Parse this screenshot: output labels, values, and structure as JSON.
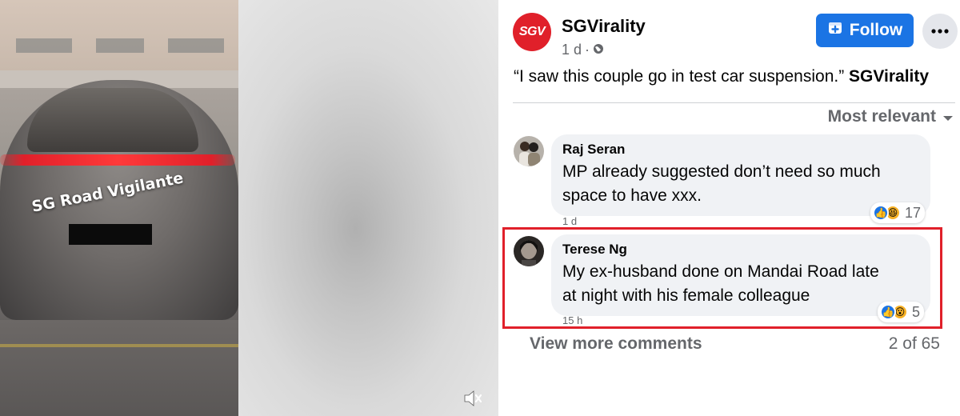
{
  "video": {
    "watermark": "SG Road Vigilante",
    "mute_icon": "speaker-muted-icon"
  },
  "post": {
    "page_name": "SGVirality",
    "avatar_text": "SGV",
    "time": "1 d",
    "separator": "·",
    "audience_icon": "globe-icon",
    "follow_label": "Follow",
    "more_icon": "more-horizontal-icon",
    "caption": "“I saw this couple go in test car suspension.”",
    "caption_tag": "SGVirality"
  },
  "comments_header": {
    "sort_label": "Most relevant"
  },
  "comments": [
    {
      "author": "Raj Seran",
      "line1": "MP already suggested don’t need so much",
      "line2": "space to have xxx.",
      "time": "1 d",
      "reactions": [
        "like",
        "haha"
      ],
      "reaction_count": "17"
    },
    {
      "author": "Terese Ng",
      "line1": "My ex-husband done on Mandai Road late",
      "line2": "at night with his female colleague",
      "time": "15 h",
      "reactions": [
        "like",
        "wow"
      ],
      "reaction_count": "5"
    }
  ],
  "footer": {
    "view_more": "View more comments",
    "count": "2 of 65"
  },
  "colors": {
    "brand_red": "#e0202a",
    "follow_blue": "#1b74e4",
    "bubble_gray": "#f0f2f5",
    "secondary_text": "#65676b"
  }
}
